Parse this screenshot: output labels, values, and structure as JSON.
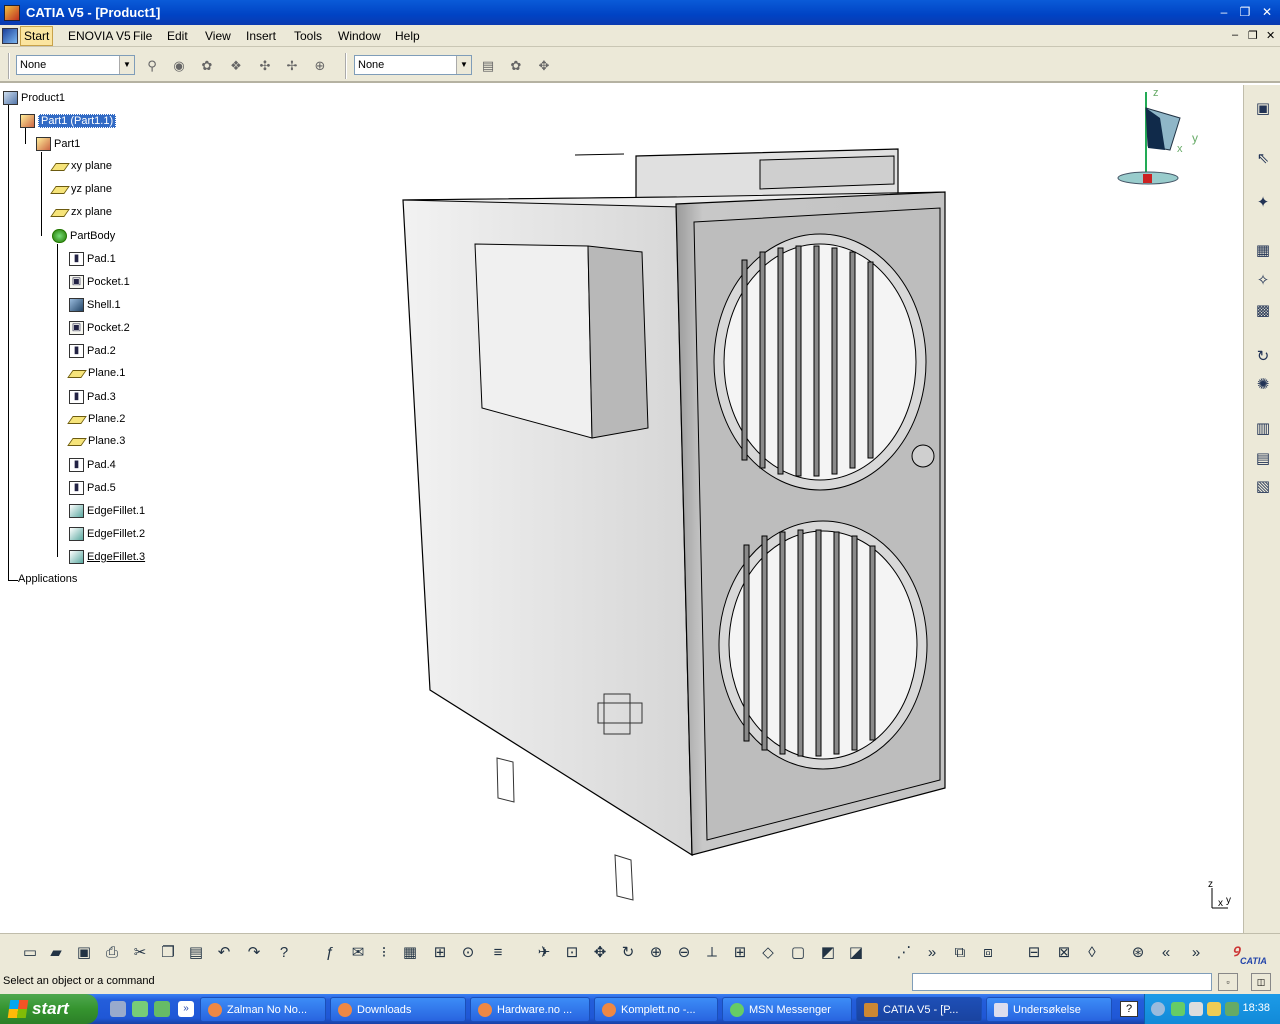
{
  "window": {
    "title": "CATIA V5 - [Product1]"
  },
  "menu": {
    "items": [
      "Start",
      "ENOVIA V5",
      "File",
      "Edit",
      "View",
      "Insert",
      "Tools",
      "Window",
      "Help"
    ]
  },
  "toolbar": {
    "combo1": "None",
    "combo2": "None"
  },
  "tree": {
    "root": "Product1",
    "part_instance": "Part1 (Part1.1)",
    "part": "Part1",
    "planes": [
      "xy plane",
      "yz plane",
      "zx plane"
    ],
    "body": "PartBody",
    "features": [
      "Pad.1",
      "Pocket.1",
      "Shell.1",
      "Pocket.2",
      "Pad.2",
      "Plane.1",
      "Pad.3",
      "Plane.2",
      "Plane.3",
      "Pad.4",
      "Pad.5",
      "EdgeFillet.1",
      "EdgeFillet.2",
      "EdgeFillet.3"
    ],
    "applications": "Applications"
  },
  "compass": {
    "z": "z",
    "x": "x",
    "y": "y"
  },
  "axis": {
    "z": "z",
    "x": "x",
    "y": "y"
  },
  "status": {
    "message": "Select an object or a command"
  },
  "branding": {
    "catia": "CATIA"
  },
  "taskbar": {
    "start": "start",
    "tasks": [
      "Zalman No No...",
      "Downloads",
      "Hardware.no ...",
      "Komplett.no -...",
      "MSN Messenger",
      "CATIA V5 - [P...",
      "Undersøkelse"
    ],
    "clock": "18:38"
  },
  "colors": {
    "titlebar": "#0043c4",
    "chrome": "#ece9d8",
    "selection": "#316ac5",
    "taskbar": "#245edb"
  }
}
